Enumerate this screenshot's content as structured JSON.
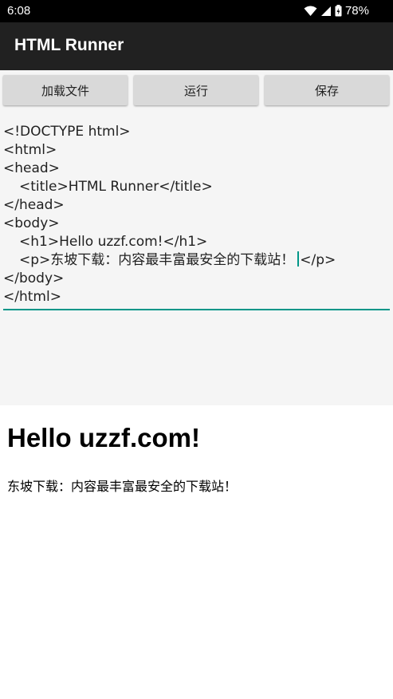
{
  "status_bar": {
    "time": "6:08",
    "battery": "78%"
  },
  "app_bar": {
    "title": "HTML Runner"
  },
  "toolbar": {
    "load_label": "加载文件",
    "run_label": "运行",
    "save_label": "保存"
  },
  "editor": {
    "lines": [
      "<!DOCTYPE html>",
      "<html>",
      "<head>",
      "<title>HTML Runner</title>",
      "</head>",
      "<body>",
      "<h1>Hello uzzf.com!</h1>",
      "<p>东坡下载：内容最丰富最安全的下载站！",
      "</p>",
      "</body>",
      "</html>"
    ]
  },
  "preview": {
    "heading": "Hello uzzf.com!",
    "paragraph": "东坡下载：内容最丰富最安全的下载站！"
  },
  "colors": {
    "accent": "#009688",
    "app_bar": "#212121",
    "status_bar": "#000000"
  }
}
